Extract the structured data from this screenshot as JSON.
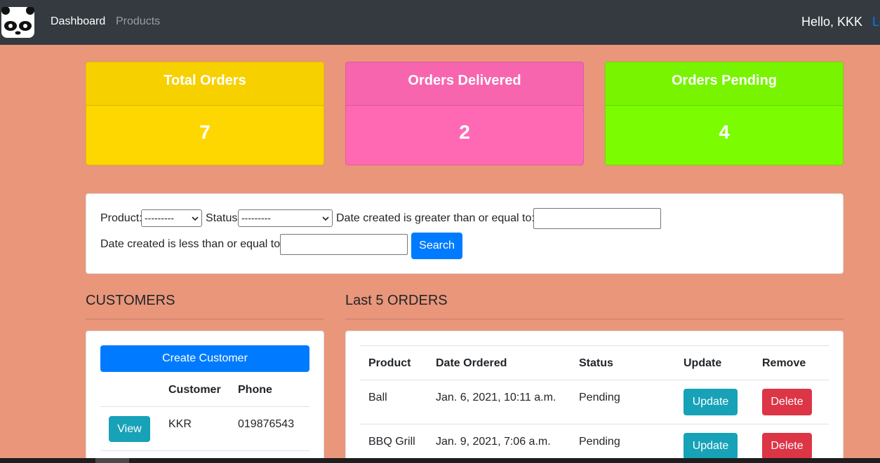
{
  "nav": {
    "dashboard": "Dashboard",
    "products": "Products",
    "greeting": "Hello, KKK",
    "logout": "Lo"
  },
  "stats": [
    {
      "title": "Total Orders",
      "value": "7",
      "color": "#ffd700"
    },
    {
      "title": "Orders Delivered",
      "value": "2",
      "color": "#ff69b4"
    },
    {
      "title": "Orders Pending",
      "value": "4",
      "color": "#7cfc00"
    }
  ],
  "filter": {
    "product_label": "Product:",
    "product_value": "---------",
    "status_label": "Status:",
    "status_value": "---------",
    "date_gte_label": "Date created is greater than or equal to:",
    "date_lte_label": "Date created is less than or equal to:",
    "search_label": "Search"
  },
  "customers": {
    "title": "CUSTOMERS",
    "create_label": "Create Customer",
    "headers": [
      "Customer",
      "Phone"
    ],
    "rows": [
      {
        "action": "View",
        "name": "KKR",
        "phone": "019876543"
      }
    ]
  },
  "orders": {
    "title": "Last 5 ORDERS",
    "headers": [
      "Product",
      "Date Ordered",
      "Status",
      "Update",
      "Remove"
    ],
    "rows": [
      {
        "product": "Ball",
        "date": "Jan. 6, 2021, 10:11 a.m.",
        "status": "Pending",
        "update": "Update",
        "remove": "Delete"
      },
      {
        "product": "BBQ Grill",
        "date": "Jan. 9, 2021, 7:06 a.m.",
        "status": "Pending",
        "update": "Update",
        "remove": "Delete"
      }
    ]
  },
  "colors": {
    "background": "#e9967a",
    "navbar": "#343a40",
    "primary": "#007bff",
    "info": "#17a2b8",
    "danger": "#dc3545"
  }
}
